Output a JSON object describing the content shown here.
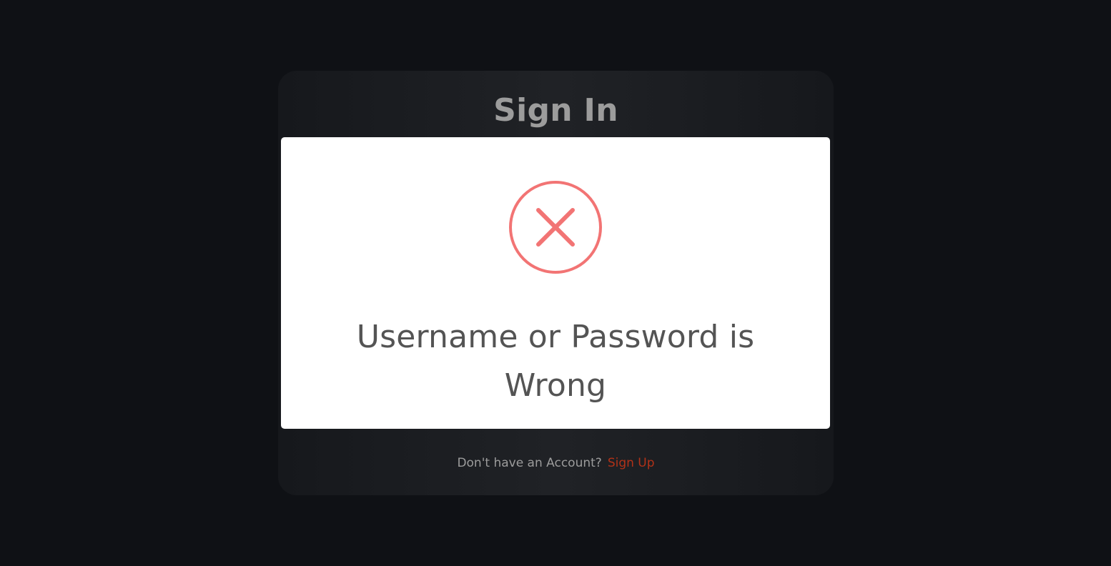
{
  "card": {
    "title": "Sign In",
    "footer_prompt": "Don't have an Account?",
    "signup_link": "Sign Up"
  },
  "modal": {
    "icon": "error-x-circle-icon",
    "message": "Username or Password is Wrong"
  },
  "colors": {
    "background": "#0f1115",
    "error_icon": "#f27474",
    "link": "#b23218",
    "message_text": "#545454"
  }
}
